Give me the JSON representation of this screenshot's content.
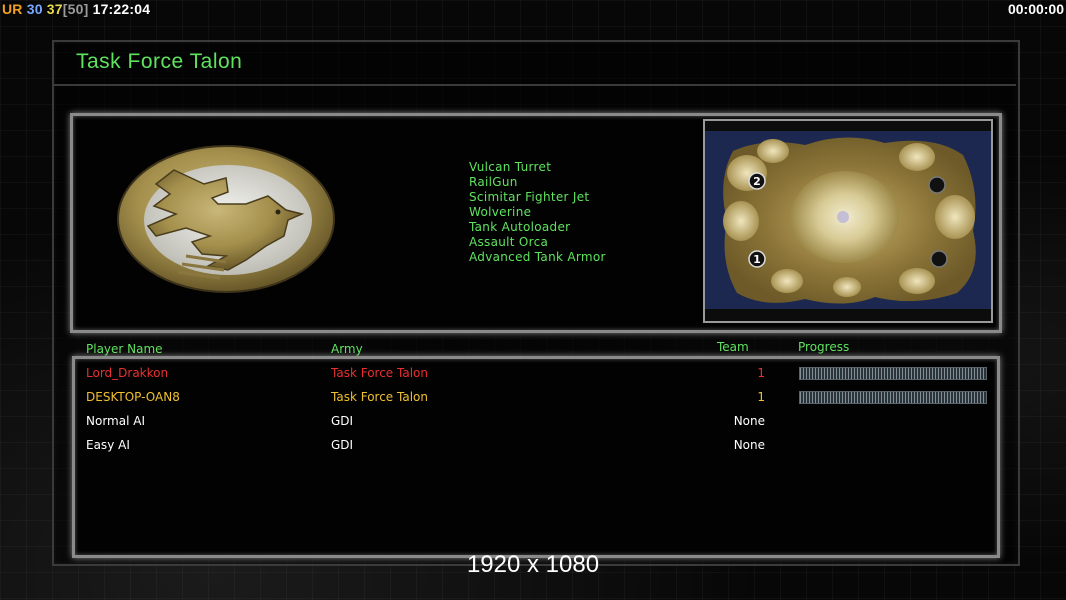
{
  "hud": {
    "ur_label": "UR",
    "fps": "30",
    "frame": "37",
    "frame_cap": "[50]",
    "clock": "17:22:04",
    "game_timer": "00:00:00"
  },
  "title": "Task Force Talon",
  "upgrades": [
    "Vulcan Turret",
    "RailGun",
    "Scimitar Fighter Jet",
    "Wolverine",
    "Tank Autoloader",
    "Assault Orca",
    "Advanced Tank Armor"
  ],
  "map": {
    "start_labels": [
      "2",
      "1"
    ]
  },
  "columns": {
    "player_name": "Player Name",
    "army": "Army",
    "team": "Team",
    "progress": "Progress"
  },
  "players": [
    {
      "name": "Lord_Drakkon",
      "army": "Task Force Talon",
      "team": "1",
      "color": "#e83030",
      "progress": 1.0
    },
    {
      "name": "DESKTOP-OAN8",
      "army": "Task Force Talon",
      "team": "1",
      "color": "#f0c030",
      "progress": 1.0
    },
    {
      "name": "Normal AI",
      "army": "GDI",
      "team": "None",
      "color": "#ffffff"
    },
    {
      "name": "Easy AI",
      "army": "GDI",
      "team": "None",
      "color": "#ffffff"
    }
  ],
  "resolution_text": "1920 x 1080",
  "colors": {
    "accent_green": "#5fe35f",
    "frame_gray": "#8a8a8a"
  }
}
